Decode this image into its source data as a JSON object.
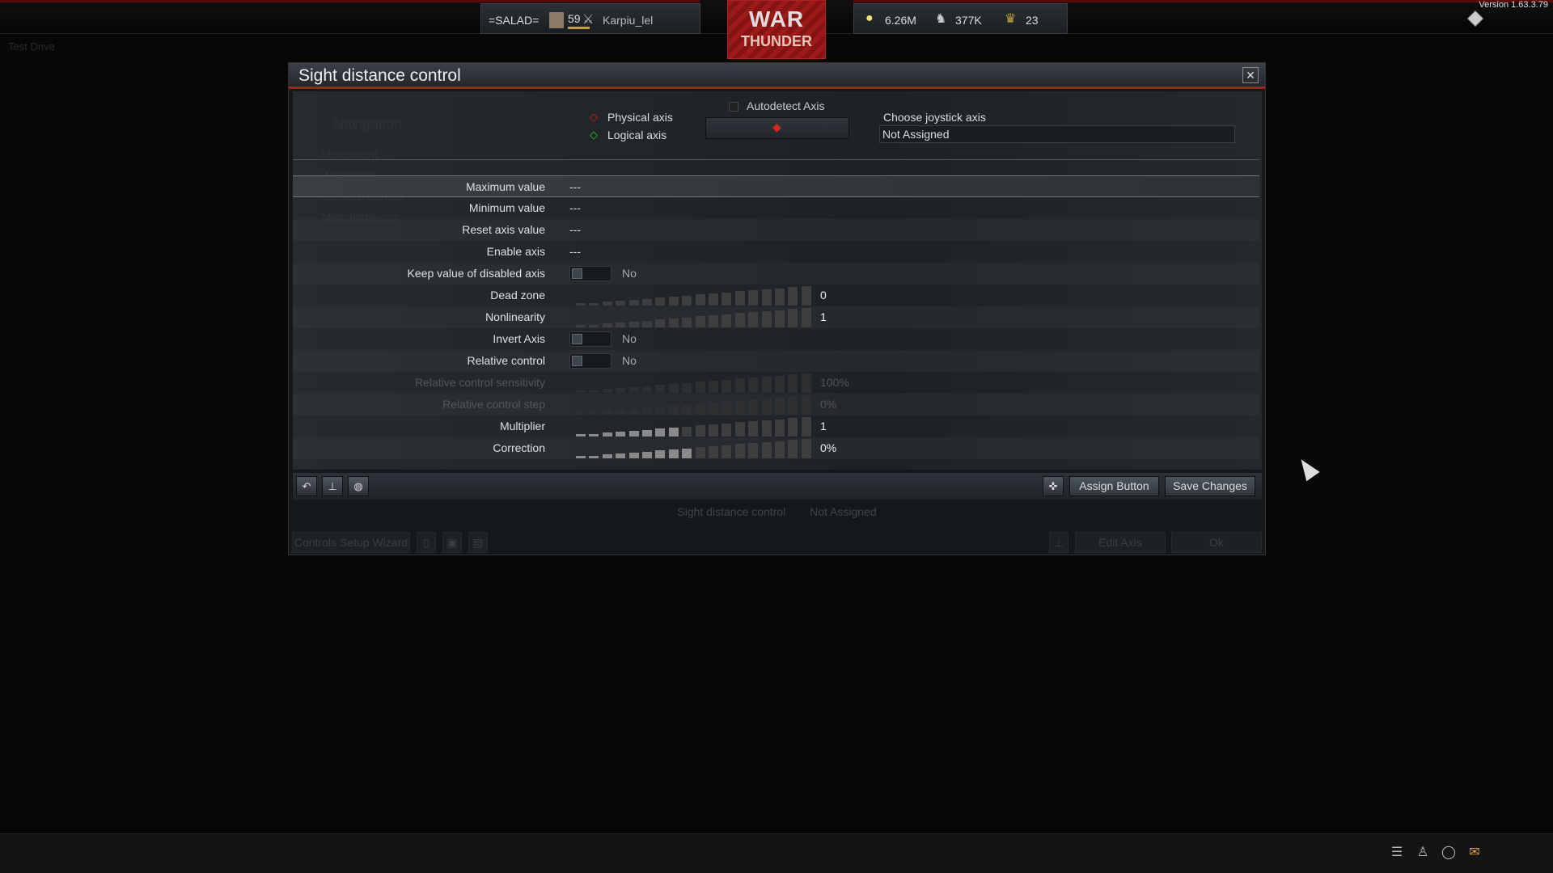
{
  "version": "Version 1.63.3.79",
  "mode": "Test Drive",
  "hud": {
    "squadron": "=SALAD=",
    "rank": "59",
    "player": "Karpiu_lel",
    "logo": [
      "WAR",
      "THUNDER"
    ],
    "silver_lions": "6.26M",
    "research": "377K",
    "golden_eagles": "23",
    "progress_fraction": 0.85
  },
  "background_menu": [
    "Navigation",
    "Movement",
    "Weaponry",
    "Camera control",
    "Miscellaneous"
  ],
  "dialog": {
    "title": "Sight distance control",
    "legend": {
      "physical": "Physical axis",
      "logical": "Logical axis"
    },
    "autodetect": "Autodetect Axis",
    "choose_axis_label": "Choose joystick axis",
    "choose_axis_value": "Not Assigned",
    "rows": [
      {
        "label": "Maximum value",
        "value": "---"
      },
      {
        "label": "Minimum value",
        "value": "---"
      },
      {
        "label": "Reset axis value",
        "value": "---"
      },
      {
        "label": "Enable axis",
        "value": "---"
      },
      {
        "label": "Keep value of disabled axis",
        "toggle": "No"
      },
      {
        "label": "Dead zone",
        "value": "0",
        "level": 0
      },
      {
        "label": "Nonlinearity",
        "value": "1",
        "level": 0
      },
      {
        "label": "Invert Axis",
        "toggle": "No"
      },
      {
        "label": "Relative control",
        "toggle": "No"
      },
      {
        "label": "Relative control sensitivity",
        "value": "100%",
        "level": 0,
        "disabled": true
      },
      {
        "label": "Relative control step",
        "value": "0%",
        "level": 0,
        "disabled": true
      },
      {
        "label": "Multiplier",
        "value": "1",
        "level": 0.44
      },
      {
        "label": "Correction",
        "value": "0%",
        "level": 0.5
      }
    ],
    "assign_button": "Assign Button",
    "save_button": "Save Changes",
    "status_name": "Sight distance control",
    "status_value": "Not Assigned",
    "wizard_button": "Controls Setup Wizard",
    "edit_axis_button": "Edit Axis",
    "ok_button": "Ok"
  }
}
